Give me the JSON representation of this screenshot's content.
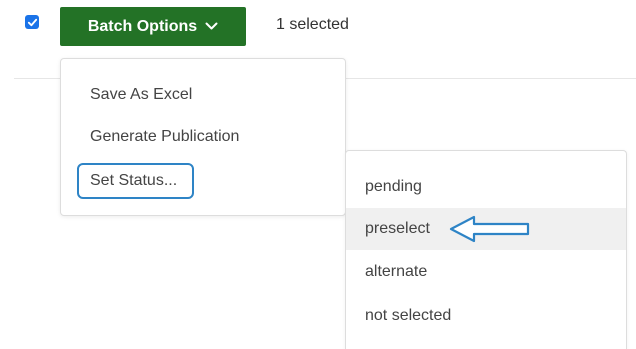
{
  "toolbar": {
    "select_all_checked": true,
    "batch_button_label": "Batch Options",
    "selected_count_text": "1 selected",
    "accent_color": "#237226",
    "checkbox_color": "#1a73e8"
  },
  "batch_menu": {
    "items": [
      {
        "label": "Save As Excel"
      },
      {
        "label": "Generate Publication"
      },
      {
        "label": "Set Status..."
      }
    ],
    "annotated_item": "Set Status...",
    "annotation_color": "#2e84c6"
  },
  "status_submenu": {
    "items": [
      {
        "label": "pending"
      },
      {
        "label": "preselect"
      },
      {
        "label": "alternate"
      },
      {
        "label": "not selected"
      }
    ],
    "hovered_item": "preselect",
    "annotation": "left-arrow-icon"
  }
}
